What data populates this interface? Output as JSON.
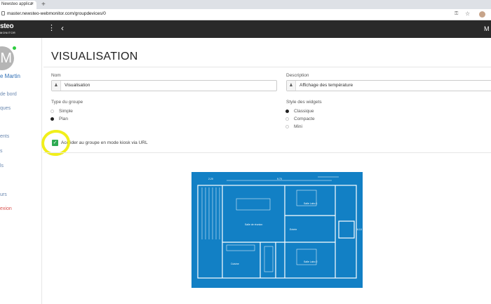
{
  "browser": {
    "tab_title": "Newsteo applica",
    "tab_close": "×",
    "new_tab": "+",
    "url": "master.newsteo-webmonitor.com/groupdevices/0"
  },
  "appbar": {
    "logo_text": "steo",
    "logo_sub": "MONITOR",
    "user_initial": "M"
  },
  "sidebar": {
    "avatar_initials": "AM",
    "user_name": "e Martin",
    "items": [
      {
        "label": "de bord"
      },
      {
        "label": "ques"
      },
      {
        "label": "ents"
      },
      {
        "label": "s"
      },
      {
        "label": "ls"
      },
      {
        "label": "urs"
      },
      {
        "label": "exion"
      }
    ]
  },
  "page": {
    "title": "VISUALISATION",
    "nom_label": "Nom",
    "nom_value": "Visualisation",
    "description_label": "Description",
    "description_value": "Affichage des température",
    "type_label": "Type du groupe",
    "type_options": [
      {
        "label": "Simple",
        "checked": false
      },
      {
        "label": "Plan",
        "checked": true
      }
    ],
    "style_label": "Style des widgets",
    "style_options": [
      {
        "label": "Classique",
        "checked": true
      },
      {
        "label": "Compacte",
        "checked": false
      },
      {
        "label": "Mini",
        "checked": false
      }
    ],
    "kiosk_label": "Accéder au groupe en mode kiosk via URL",
    "kiosk_checked": true,
    "kiosk_checkmark": "✓"
  },
  "floorplan": {
    "dimension_left": "2.20",
    "dimension_top": "9.70",
    "dimension_right": "6.10",
    "rooms": {
      "salle_reunion": "Salle de réunion",
      "salle_labo_1": "Salle Labo 1",
      "salle_labo_2": "Salle Labo 2",
      "entree": "Entrée",
      "cuisine": "Cuisine"
    }
  },
  "colors": {
    "plan_background": "#1280c5",
    "highlight": "#f1ef1b",
    "checkbox": "#2eaa52",
    "logout": "#d9534f"
  }
}
